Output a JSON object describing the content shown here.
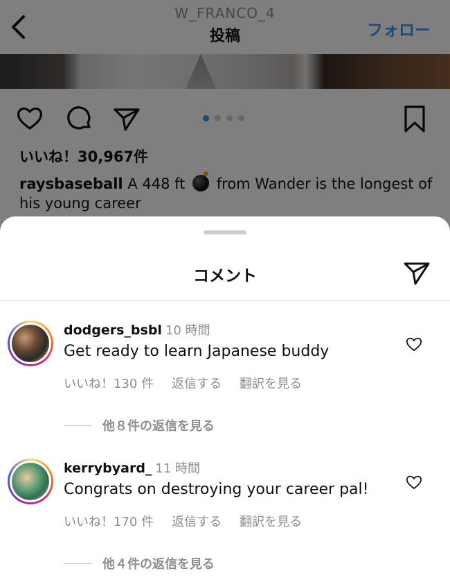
{
  "header": {
    "username": "W_FRANCO_4",
    "title": "投稿",
    "follow_label": "フォロー"
  },
  "post": {
    "carousel_count": 4,
    "carousel_active": 1,
    "likes": "いいね！30,967件",
    "caption_user": "raysbaseball",
    "caption_before_emoji": "A 448 ft",
    "caption_emoji": "bomb",
    "caption_after_emoji": "from Wander is the longest of his young career"
  },
  "comments_sheet": {
    "title": "コメント",
    "comments": [
      {
        "user": "dodgers_bsbl",
        "time": "10 時間",
        "text": "Get ready to learn Japanese buddy",
        "likes": "いいね！130 件",
        "reply_label": "返信する",
        "translate_label": "翻訳を見る",
        "view_replies": "他８件の返信を見る"
      },
      {
        "user": "kerrybyard_",
        "time": "11 時間",
        "text": "Congrats on destroying your career pal!",
        "likes": "いいね！170 件",
        "reply_label": "返信する",
        "translate_label": "翻訳を見る",
        "view_replies": "他４件の返信を見る"
      }
    ]
  },
  "colors": {
    "accent": "#3897f0",
    "muted_text": "#8e8e8e",
    "overlay": "rgba(0,0,0,0.5)"
  },
  "icons": [
    "chevron-left-icon",
    "heart-icon",
    "comment-icon",
    "send-icon",
    "bookmark-icon",
    "bomb-emoji",
    "small-heart-icon"
  ]
}
